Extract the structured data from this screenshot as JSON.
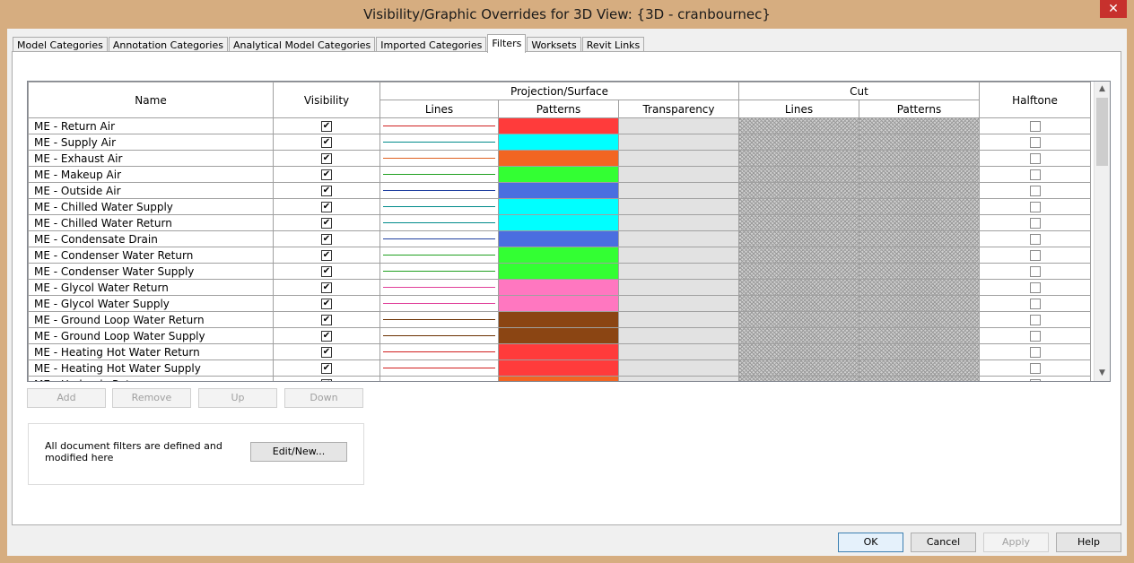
{
  "window": {
    "title": "Visibility/Graphic Overrides for 3D View: {3D - cranbournec}",
    "close_icon": "close-icon"
  },
  "tabs": [
    {
      "label": "Model Categories",
      "active": false
    },
    {
      "label": "Annotation Categories",
      "active": false
    },
    {
      "label": "Analytical Model Categories",
      "active": false
    },
    {
      "label": "Imported Categories",
      "active": false
    },
    {
      "label": "Filters",
      "active": true
    },
    {
      "label": "Worksets",
      "active": false
    },
    {
      "label": "Revit Links",
      "active": false
    }
  ],
  "grid": {
    "headers": {
      "name": "Name",
      "visibility": "Visibility",
      "projection_surface": "Projection/Surface",
      "cut": "Cut",
      "halftone": "Halftone",
      "proj_lines": "Lines",
      "proj_patterns": "Patterns",
      "proj_transparency": "Transparency",
      "cut_lines": "Lines",
      "cut_patterns": "Patterns"
    },
    "rows": [
      {
        "name": "ME - Return Air",
        "visible": true,
        "line_color": "#d02020",
        "pattern_color": "#ff3b3b",
        "halftone": false
      },
      {
        "name": "ME - Supply Air",
        "visible": true,
        "line_color": "#008b8b",
        "pattern_color": "#00ffff",
        "halftone": false
      },
      {
        "name": "ME - Exhaust Air",
        "visible": true,
        "line_color": "#e06020",
        "pattern_color": "#f26522",
        "halftone": false
      },
      {
        "name": "ME - Makeup Air",
        "visible": true,
        "line_color": "#20a020",
        "pattern_color": "#33ff33",
        "halftone": false
      },
      {
        "name": "ME - Outside Air",
        "visible": true,
        "line_color": "#2040a0",
        "pattern_color": "#4a6ee0",
        "halftone": false
      },
      {
        "name": "ME - Chilled Water Supply",
        "visible": true,
        "line_color": "#008b8b",
        "pattern_color": "#00ffff",
        "halftone": false
      },
      {
        "name": "ME - Chilled Water Return",
        "visible": true,
        "line_color": "#008b8b",
        "pattern_color": "#00ffff",
        "halftone": false
      },
      {
        "name": "ME - Condensate Drain",
        "visible": true,
        "line_color": "#2040a0",
        "pattern_color": "#4a6ee0",
        "halftone": false
      },
      {
        "name": "ME - Condenser Water Return",
        "visible": true,
        "line_color": "#20a020",
        "pattern_color": "#33ff33",
        "halftone": false
      },
      {
        "name": "ME - Condenser Water Supply",
        "visible": true,
        "line_color": "#20a020",
        "pattern_color": "#33ff33",
        "halftone": false
      },
      {
        "name": "ME - Glycol Water Return",
        "visible": true,
        "line_color": "#e0409a",
        "pattern_color": "#ff77c0",
        "halftone": false
      },
      {
        "name": "ME - Glycol Water Supply",
        "visible": true,
        "line_color": "#e0409a",
        "pattern_color": "#ff77c0",
        "halftone": false
      },
      {
        "name": "ME - Ground Loop Water Return",
        "visible": true,
        "line_color": "#6a3000",
        "pattern_color": "#8b4513",
        "halftone": false
      },
      {
        "name": "ME - Ground Loop Water Supply",
        "visible": true,
        "line_color": "#6a3000",
        "pattern_color": "#8b4513",
        "halftone": false
      },
      {
        "name": "ME - Heating Hot Water Return",
        "visible": true,
        "line_color": "#d02020",
        "pattern_color": "#ff3b3b",
        "halftone": false
      },
      {
        "name": "ME - Heating Hot Water Supply",
        "visible": true,
        "line_color": "#d02020",
        "pattern_color": "#ff3b3b",
        "halftone": false
      },
      {
        "name": "ME - Hydronic Return",
        "visible": true,
        "line_color": "#e06020",
        "pattern_color": "#f26522",
        "halftone": false
      }
    ]
  },
  "grid_buttons": {
    "add": "Add",
    "remove": "Remove",
    "up": "Up",
    "down": "Down"
  },
  "info": {
    "text": "All document filters are defined and modified here",
    "edit_button": "Edit/New..."
  },
  "footer": {
    "ok": "OK",
    "cancel": "Cancel",
    "apply": "Apply",
    "help": "Help"
  }
}
